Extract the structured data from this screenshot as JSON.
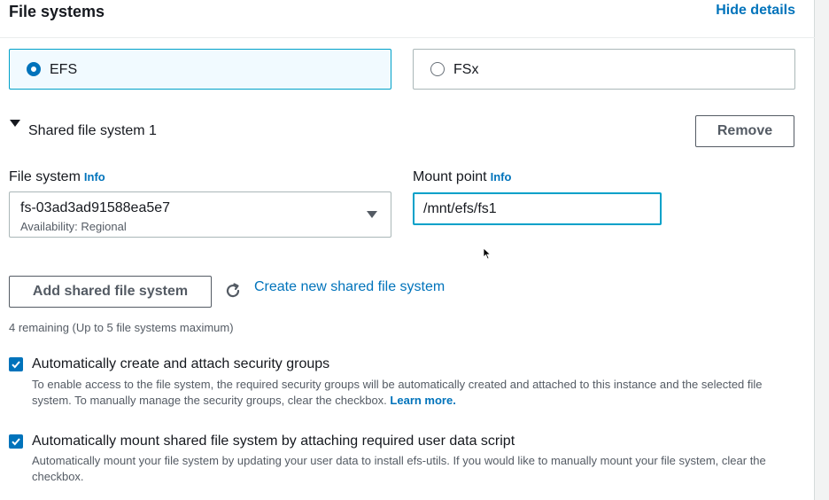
{
  "header": {
    "title": "File systems",
    "hide_details": "Hide details"
  },
  "fs_type": {
    "options": [
      {
        "label": "EFS",
        "selected": true
      },
      {
        "label": "FSx",
        "selected": false
      }
    ]
  },
  "shared": {
    "title": "Shared file system 1",
    "remove_label": "Remove",
    "file_system_label": "File system",
    "file_system_info": "Info",
    "file_system_value": "fs-03ad3ad91588ea5e7",
    "file_system_sub": "Availability: Regional",
    "mount_point_label": "Mount point",
    "mount_point_info": "Info",
    "mount_point_value": "/mnt/efs/fs1"
  },
  "actions": {
    "add_label": "Add shared file system",
    "create_link": "Create new shared file system",
    "remaining": "4 remaining (Up to 5 file systems maximum)"
  },
  "options": {
    "security_groups": {
      "label": "Automatically create and attach security groups",
      "checked": true,
      "description": "To enable access to the file system, the required security groups will be automatically created and attached to this instance and the selected file system. To manually manage the security groups, clear the checkbox.",
      "learn_more": "Learn more."
    },
    "auto_mount": {
      "label": "Automatically mount shared file system by attaching required user data script",
      "checked": true,
      "description": "Automatically mount your file system by updating your user data to install efs-utils. If you would like to manually mount your file system, clear the checkbox."
    }
  },
  "colors": {
    "link": "#0073bb",
    "selected_border": "#00a1c9",
    "selected_bg": "#f1faff"
  }
}
